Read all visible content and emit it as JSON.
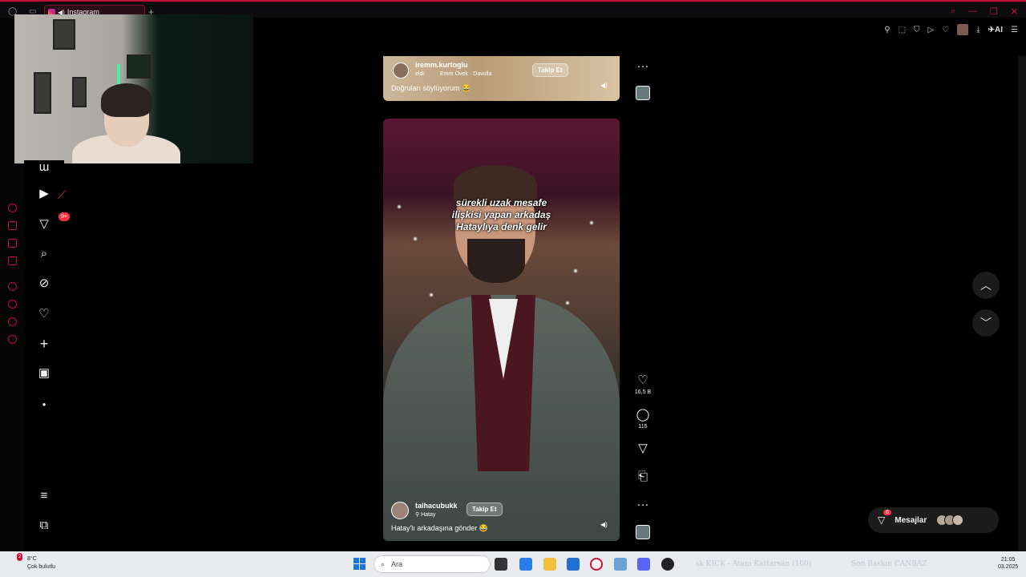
{
  "browser": {
    "tab_title": "Instagram",
    "new_tab": "+",
    "toolbar_ai": "AI"
  },
  "reel_top": {
    "username": "iremm.kurtoglu",
    "meta_left": "eldi",
    "audio": "Emre Övek · Davulla",
    "follow_label": "Takip Et",
    "caption": "Doğruları söylüyorum 😂"
  },
  "reel_main": {
    "overlay_text_1": "sürekli uzak mesafe",
    "overlay_text_2": "ilişkisi yapan arkadaş",
    "overlay_text_3": "Hataylıya denk gelir",
    "username": "talhacubukk",
    "follow_label": "Takip Et",
    "location": "Hatay",
    "caption": "Hatay'lı arkadaşına gönder 😂"
  },
  "actions": {
    "more": "···",
    "like_count": "16,5 B",
    "comment_count": "115"
  },
  "nav": {
    "notifications_badge": "9+"
  },
  "messages": {
    "label": "Mesajlar",
    "badge": "6"
  },
  "taskbar": {
    "weather_temp": "8°C",
    "weather_desc": "Çok bulutlu",
    "weather_badge": "2",
    "search_placeholder": "Ara",
    "app_text_1": "sk KICK - Atanı Kattarsan (100)",
    "app_text_2": "Son Baskın CANBAZ",
    "time": "21:05",
    "date": "03.2025"
  },
  "colors": {
    "opera_red": "#c0103a",
    "badge_red": "#ff3040"
  }
}
